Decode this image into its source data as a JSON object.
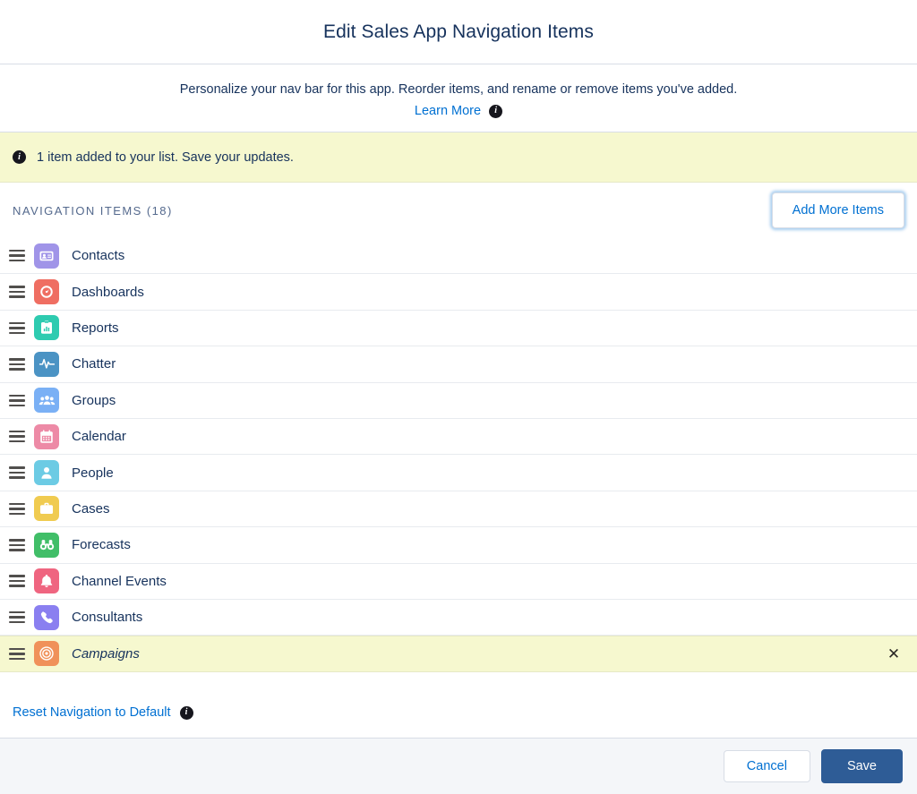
{
  "modal": {
    "title": "Edit Sales App Navigation Items",
    "intro_text": "Personalize your nav bar for this app. Reorder items, and rename or remove items you've added.",
    "learn_more_label": "Learn More",
    "learn_more_info_icon": "info-icon",
    "close_icon": "close-icon"
  },
  "banner": {
    "icon": "info-icon",
    "message": "1 item added to your list. Save your updates."
  },
  "section": {
    "label": "NAVIGATION ITEMS (18)",
    "count": 18,
    "add_more_label": "Add More Items"
  },
  "nav_items": [
    {
      "label": "Contacts",
      "icon": "contact-card-icon",
      "color": "#a094e8",
      "highlight": false,
      "italic": false,
      "removable": false
    },
    {
      "label": "Dashboards",
      "icon": "gauge-icon",
      "color": "#ef6e62",
      "highlight": false,
      "italic": false,
      "removable": false
    },
    {
      "label": "Reports",
      "icon": "clipboard-chart-icon",
      "color": "#2ecbb0",
      "highlight": false,
      "italic": false,
      "removable": false
    },
    {
      "label": "Chatter",
      "icon": "pulse-icon",
      "color": "#4b93c4",
      "highlight": false,
      "italic": false,
      "removable": false
    },
    {
      "label": "Groups",
      "icon": "people-group-icon",
      "color": "#7ab0f5",
      "highlight": false,
      "italic": false,
      "removable": false
    },
    {
      "label": "Calendar",
      "icon": "calendar-icon",
      "color": "#ed8aa6",
      "highlight": false,
      "italic": false,
      "removable": false
    },
    {
      "label": "People",
      "icon": "person-icon",
      "color": "#6ccbe4",
      "highlight": false,
      "italic": false,
      "removable": false
    },
    {
      "label": "Cases",
      "icon": "briefcase-icon",
      "color": "#f0cb50",
      "highlight": false,
      "italic": false,
      "removable": false
    },
    {
      "label": "Forecasts",
      "icon": "binoculars-icon",
      "color": "#41be68",
      "highlight": false,
      "italic": false,
      "removable": false
    },
    {
      "label": "Channel Events",
      "icon": "bell-icon",
      "color": "#ef6580",
      "highlight": false,
      "italic": false,
      "removable": false
    },
    {
      "label": "Consultants",
      "icon": "phone-icon",
      "color": "#8a7ff0",
      "highlight": false,
      "italic": false,
      "removable": false
    },
    {
      "label": "Campaigns",
      "icon": "target-icon",
      "color": "#f0915a",
      "highlight": true,
      "italic": true,
      "removable": true
    }
  ],
  "reset": {
    "label": "Reset Navigation to Default",
    "info_icon": "info-icon"
  },
  "footer": {
    "cancel_label": "Cancel",
    "save_label": "Save"
  },
  "colors": {
    "accent_link": "#0070d2",
    "save_button": "#2e5c96",
    "banner_bg": "#f6f8cf",
    "text": "#16325c",
    "section_label": "#54698d"
  }
}
